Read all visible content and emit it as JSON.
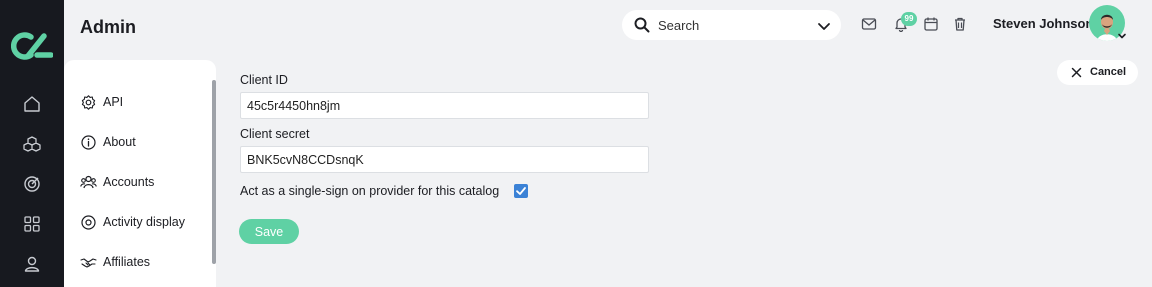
{
  "app": {
    "title": "Admin"
  },
  "sidebar_rail": {
    "logo": "brand-logo",
    "items": [
      {
        "icon": "home-icon"
      },
      {
        "icon": "cubes-icon"
      },
      {
        "icon": "target-icon"
      },
      {
        "icon": "grid-icon"
      },
      {
        "icon": "user-icon"
      }
    ]
  },
  "header": {
    "search": {
      "placeholder": "Search"
    },
    "notifications_count": "99",
    "user_name": "Steven Johnson"
  },
  "settings_nav": {
    "items": [
      {
        "label": "API",
        "icon": "gear-icon"
      },
      {
        "label": "About",
        "icon": "info-icon"
      },
      {
        "label": "Accounts",
        "icon": "users-icon"
      },
      {
        "label": "Activity display",
        "icon": "activity-icon"
      },
      {
        "label": "Affiliates",
        "icon": "handshake-icon"
      }
    ]
  },
  "form": {
    "client_id": {
      "label": "Client ID",
      "value": "45c5r4450hn8jm"
    },
    "client_secret": {
      "label": "Client secret",
      "value": "BNK5cvN8CCDsnqK"
    },
    "sso": {
      "label": "Act as a single-sign on provider for this catalog",
      "checked": true
    },
    "save_label": "Save",
    "cancel_label": "Cancel"
  },
  "colors": {
    "accent": "#5fd1a4",
    "rail": "#17191f",
    "checkbox": "#3b82d6",
    "background": "#f1f2f4"
  }
}
